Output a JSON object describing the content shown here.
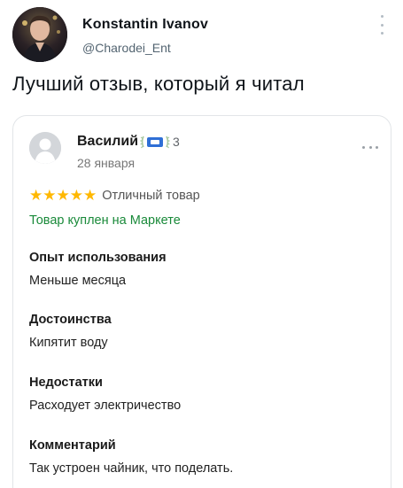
{
  "tweet": {
    "author_name": "Konstantin Ivanov",
    "author_handle": "@Charodei_Ent",
    "text": "Лучший отзыв, который я читал"
  },
  "review": {
    "reviewer_name": "Василий",
    "level": "3",
    "date": "28 января",
    "rating": 5,
    "rating_label": "Отличный товар",
    "purchase_status": "Товар куплен на Маркете",
    "sections": [
      {
        "title": "Опыт использования",
        "body": "Меньше месяца"
      },
      {
        "title": "Достоинства",
        "body": "Кипятит воду"
      },
      {
        "title": "Недостатки",
        "body": "Расходует электричество"
      },
      {
        "title": "Комментарий",
        "body": "Так устроен чайник, что поделать."
      }
    ]
  },
  "colors": {
    "star": "#ffb800",
    "purchase_link": "#1a8a3a",
    "handle": "#536471",
    "card_border": "#e2e5e8"
  },
  "icons": {
    "tweet_menu": "more-vertical-icon",
    "review_menu": "more-horizontal-icon",
    "badge": "laurel-badge-icon",
    "star": "star-icon"
  }
}
